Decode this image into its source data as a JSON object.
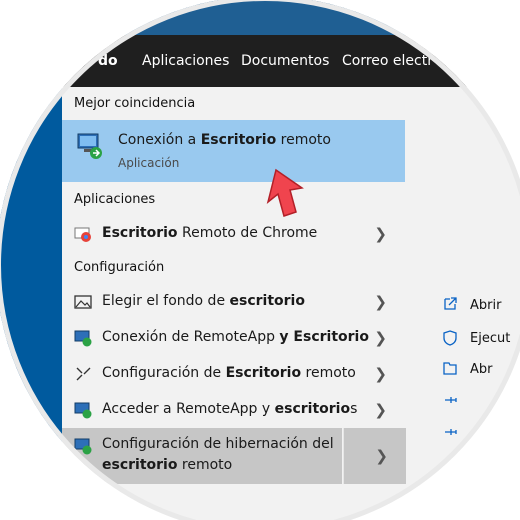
{
  "tabs": [
    {
      "label": "Todo",
      "visible_label": "do"
    },
    {
      "label": "Aplicaciones"
    },
    {
      "label": "Documentos"
    },
    {
      "label": "Correo electr"
    }
  ],
  "best_match": {
    "heading": "Mejor coincidencia",
    "title_prefix": "Conexión a ",
    "title_bold": "Escritorio",
    "title_suffix": " remoto",
    "subtitle": "Aplicación",
    "icon": "remote-desktop-icon"
  },
  "apps_section": {
    "heading": "Aplicaciones",
    "items": [
      {
        "bold": "Escritorio",
        "suffix": " Remoto de Chrome",
        "icon": "chrome-remote-icon"
      }
    ]
  },
  "config_section": {
    "heading": "Configuración",
    "items": [
      {
        "prefix": "Elegir el fondo de ",
        "bold": "escritorio",
        "suffix": "",
        "icon": "image-icon"
      },
      {
        "prefix": "Conexión de RemoteApp ",
        "bold": "y Escritorio",
        "suffix": "",
        "icon": "remote-app-icon"
      },
      {
        "prefix": "Configuración de ",
        "bold": "Escritorio",
        "suffix": " remoto",
        "icon": "remote-config-icon"
      },
      {
        "prefix": "Acceder a RemoteApp y ",
        "bold": "escritorio",
        "suffix": "s",
        "icon": "remote-app-icon"
      },
      {
        "prefix": "Configuración de hibernación del",
        "line2_bold": "escritorio",
        "line2_suffix": " remoto",
        "icon": "remote-app-icon",
        "highlighted": true
      }
    ]
  },
  "right_panel": {
    "items": [
      {
        "label": "Abrir",
        "icon": "open-icon"
      },
      {
        "label": "Ejecut",
        "icon": "shield-icon"
      },
      {
        "label": "Abr",
        "icon": "folder-icon"
      },
      {
        "label": "",
        "icon": "pin-icon"
      },
      {
        "label": "",
        "icon": "pin-icon"
      }
    ]
  },
  "colors": {
    "selection": "#99c9ef",
    "tab_bar": "#1f1f1f",
    "arrow": "#f0444e"
  }
}
